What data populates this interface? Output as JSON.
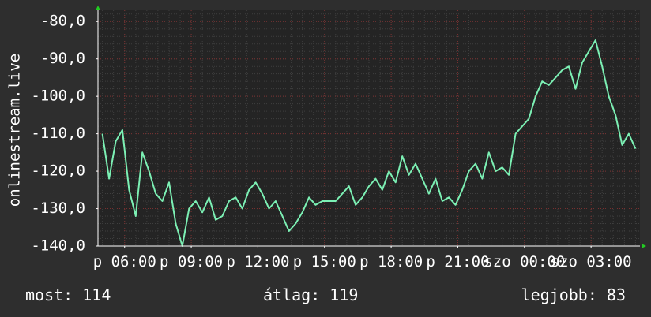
{
  "chart_data": {
    "type": "line",
    "ylabel": "onlinestream.live",
    "ylim": [
      -140,
      -77
    ],
    "yticks": [
      -80,
      -90,
      -100,
      -110,
      -120,
      -130,
      -140
    ],
    "ytick_labels": [
      "-80,0",
      "-90,0",
      "-100,0",
      "-110,0",
      "-120,0",
      "-130,0",
      "-140,0"
    ],
    "xlim": [
      4.8,
      29.2
    ],
    "xticks": [
      6,
      9,
      12,
      15,
      18,
      21,
      24,
      27
    ],
    "xtick_labels": [
      "p 06:00",
      "p 09:00",
      "p 12:00",
      "p 15:00",
      "p 18:00",
      "p 21:00",
      "szo 00:00",
      "szo 03:00"
    ],
    "grid": true,
    "colors": {
      "background": "#2e2e2e",
      "plot_area": "#242424",
      "line": "#7cf0b4",
      "grid_major": "#7a3030",
      "grid_minor": "#3f3f3f",
      "axis": "#ffffff",
      "arrow": "#22cc22"
    },
    "series": [
      {
        "x": [
          5.0,
          5.3,
          5.6,
          5.9,
          6.2,
          6.5,
          6.8,
          7.1,
          7.4,
          7.7,
          8.0,
          8.3,
          8.6,
          8.9,
          9.2,
          9.5,
          9.8,
          10.1,
          10.4,
          10.7,
          11.0,
          11.3,
          11.6,
          11.9,
          12.2,
          12.5,
          12.8,
          13.1,
          13.4,
          13.7,
          14.0,
          14.3,
          14.6,
          14.9,
          15.2,
          15.5,
          15.8,
          16.1,
          16.4,
          16.7,
          17.0,
          17.3,
          17.6,
          17.9,
          18.2,
          18.5,
          18.8,
          19.1,
          19.4,
          19.7,
          20.0,
          20.3,
          20.6,
          20.9,
          21.2,
          21.5,
          21.8,
          22.1,
          22.4,
          22.7,
          23.0,
          23.3,
          23.6,
          23.9,
          24.2,
          24.5,
          24.8,
          25.1,
          25.4,
          25.7,
          26.0,
          26.3,
          26.6,
          26.9,
          27.2,
          27.5,
          27.8,
          28.1,
          28.4,
          28.7,
          29.0
        ],
        "y": [
          -110,
          -122,
          -112,
          -109,
          -125,
          -132,
          -115,
          -120,
          -126,
          -128,
          -123,
          -134,
          -140,
          -130,
          -128,
          -131,
          -127,
          -133,
          -132,
          -128,
          -127,
          -130,
          -125,
          -123,
          -126,
          -130,
          -128,
          -132,
          -136,
          -134,
          -131,
          -127,
          -129,
          -128,
          -128,
          -128,
          -126,
          -124,
          -129,
          -127,
          -124,
          -122,
          -125,
          -120,
          -123,
          -116,
          -121,
          -118,
          -122,
          -126,
          -122,
          -128,
          -127,
          -129,
          -125,
          -120,
          -118,
          -122,
          -115,
          -120,
          -119,
          -121,
          -110,
          -108,
          -106,
          -100,
          -96,
          -97,
          -95,
          -93,
          -92,
          -98,
          -91,
          -88,
          -85,
          -92,
          -100,
          -105,
          -113,
          -110,
          -114
        ]
      }
    ]
  },
  "stats": {
    "current": "most: 114",
    "average": "átlag: 119",
    "best": "legjobb: 83"
  }
}
